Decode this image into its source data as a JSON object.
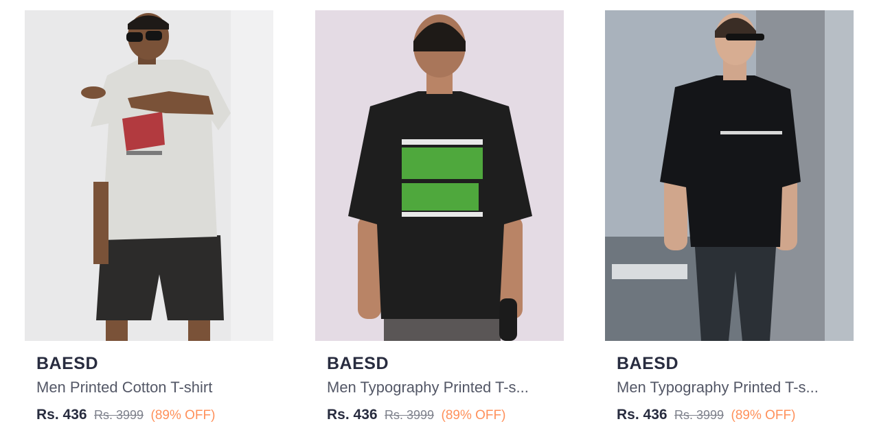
{
  "products": [
    {
      "brand": "BAESD",
      "title": "Men Printed Cotton T-shirt",
      "price": "Rs. 436",
      "mrp": "Rs. 3999",
      "discount": "(89% OFF)"
    },
    {
      "brand": "BAESD",
      "title": "Men Typography Printed T-s...",
      "price": "Rs. 436",
      "mrp": "Rs. 3999",
      "discount": "(89% OFF)"
    },
    {
      "brand": "BAESD",
      "title": "Men Typography Printed T-s...",
      "price": "Rs. 436",
      "mrp": "Rs. 3999",
      "discount": "(89% OFF)"
    }
  ],
  "colors": {
    "brand_text": "#282c3f",
    "title_text": "#535766",
    "mrp_text": "#7e818c",
    "discount_text": "#ff905a"
  }
}
